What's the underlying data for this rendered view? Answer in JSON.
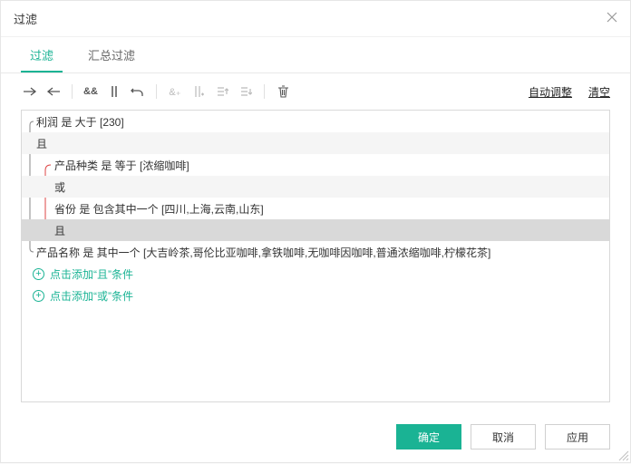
{
  "dialog": {
    "title": "过滤"
  },
  "tabs": {
    "filter": "过滤",
    "summary": "汇总过滤"
  },
  "toolbar": {
    "auto_adjust": "自动调整",
    "clear": "清空"
  },
  "filters": {
    "row0": "利润 是 大于 [230]",
    "row1": "且",
    "row2": "产品种类 是 等于 [浓缩咖啡]",
    "row3": "或",
    "row4": "省份 是 包含其中一个 [四川,上海,云南,山东]",
    "row5": "且",
    "row6": "产品名称 是 其中一个 [大吉岭茶,哥伦比亚咖啡,拿铁咖啡,无咖啡因咖啡,普通浓缩咖啡,柠檬花茶]"
  },
  "actions": {
    "add_and": "点击添加“且”条件",
    "add_or": "点击添加“或”条件"
  },
  "footer": {
    "ok": "确定",
    "cancel": "取消",
    "apply": "应用"
  }
}
